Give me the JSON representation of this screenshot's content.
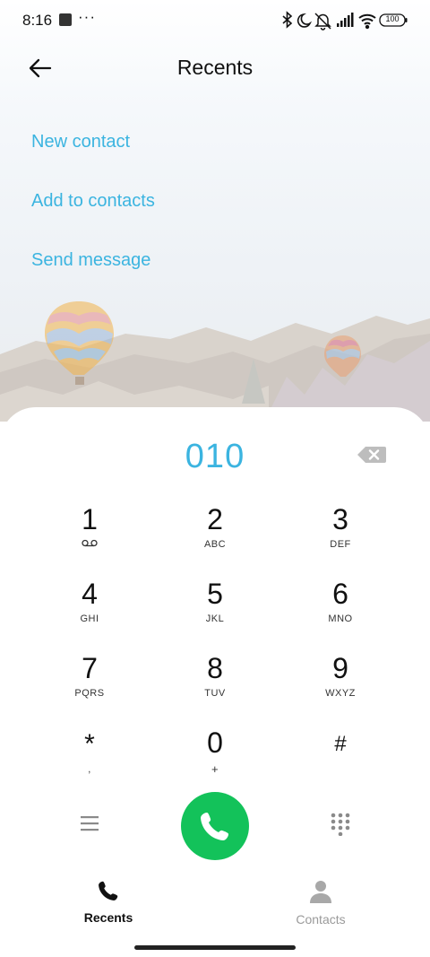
{
  "status_bar": {
    "time": "8:16",
    "dots": "···",
    "battery": "100"
  },
  "header": {
    "title": "Recents"
  },
  "actions": {
    "new_contact": "New contact",
    "add_to_contacts": "Add to contacts",
    "send_message": "Send message"
  },
  "dialer": {
    "number": "010",
    "keys": [
      {
        "digit": "1",
        "letters": ""
      },
      {
        "digit": "2",
        "letters": "ABC"
      },
      {
        "digit": "3",
        "letters": "DEF"
      },
      {
        "digit": "4",
        "letters": "GHI"
      },
      {
        "digit": "5",
        "letters": "JKL"
      },
      {
        "digit": "6",
        "letters": "MNO"
      },
      {
        "digit": "7",
        "letters": "PQRS"
      },
      {
        "digit": "8",
        "letters": "TUV"
      },
      {
        "digit": "9",
        "letters": "WXYZ"
      },
      {
        "digit": "*",
        "letters": ","
      },
      {
        "digit": "0",
        "letters": "+"
      },
      {
        "digit": "#",
        "letters": ""
      }
    ]
  },
  "tabs": {
    "recents": "Recents",
    "contacts": "Contacts"
  },
  "colors": {
    "accent": "#3bb4e0",
    "call_green": "#13c25a",
    "inactive_tab": "#9a9a9a"
  },
  "icons": {
    "back": "back-arrow-icon",
    "backspace": "backspace-icon",
    "menu": "menu-icon",
    "keypad": "keypad-icon",
    "call": "phone-icon",
    "recents_tab": "phone-icon",
    "contacts_tab": "person-icon",
    "voicemail": "voicemail-icon"
  }
}
